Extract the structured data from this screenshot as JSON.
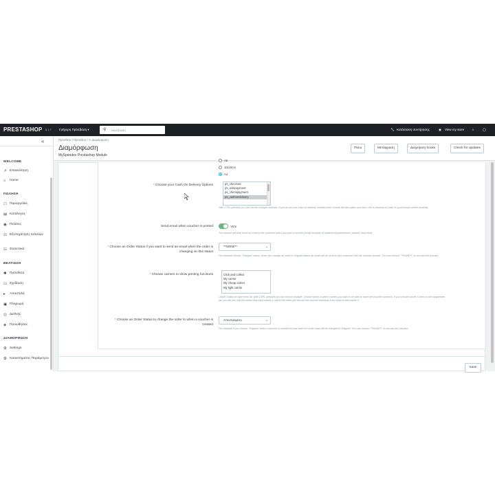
{
  "topbar": {
    "logo": "PRESTASHOP",
    "version": "8.1.7",
    "quick_access": "Γρήγορη Πρόσβαση ▾",
    "search_placeholder": "Αναζήτηση",
    "maintenance": "Κατάσταση συντήρησης",
    "view_store": "View my store"
  },
  "sidebar": {
    "sections": [
      {
        "title": "WELCOME",
        "items": [
          {
            "icon": "trend-icon",
            "label": "Επισκόπηση"
          },
          {
            "icon": "home-icon",
            "label": "Home"
          }
        ]
      },
      {
        "title": "ΠΩΛΗΣΗ",
        "items": [
          {
            "icon": "cart-icon",
            "label": "Παραγγελίες"
          },
          {
            "icon": "catalog-icon",
            "label": "Κατάλογος"
          },
          {
            "icon": "customer-icon",
            "label": "Πελάτες"
          },
          {
            "icon": "chat-icon",
            "label": "Εξυπηρέτηση πελατών"
          },
          {
            "icon": "stats-icon",
            "label": "Στατιστικά"
          }
        ]
      },
      {
        "title": "ΒΕΛΤΙΩΣΗ",
        "items": [
          {
            "icon": "puzzle-icon",
            "label": "Πρόσθετα"
          },
          {
            "icon": "monitor-icon",
            "label": "Σχεδίαση"
          },
          {
            "icon": "truck-icon",
            "label": "Αποστολή"
          },
          {
            "icon": "payment-icon",
            "label": "Πληρωμή"
          },
          {
            "icon": "globe-icon",
            "label": "Διεθνής"
          },
          {
            "icon": "promo-icon",
            "label": "Προωθήσεις"
          }
        ]
      },
      {
        "title": "ΔΙΑΜΟΡΦΩΣΗ",
        "items": [
          {
            "icon": "settings-icon",
            "label": "Settings"
          },
          {
            "icon": "params-icon",
            "label": "Καταστήματος Παράμετροι"
          }
        ]
      }
    ]
  },
  "header": {
    "breadcrumb": "Πρόσθετα  /  Πρόσθετα  /  ✎ Διαμόρφωση",
    "title": "Διαμόρφωση",
    "subtitle": "MySpeedex Prestashop Module",
    "buttons": [
      "Πίσω",
      "Μετάφραση",
      "Διαχείριση hooks",
      "Check for updates"
    ]
  },
  "form": {
    "radios": [
      {
        "label": "A6",
        "checked": false
      },
      {
        "label": "10x15cm",
        "checked": false
      },
      {
        "label": "A4",
        "checked": true
      }
    ],
    "cod_label": "Choose your Cash On Delivery Options",
    "cod_options": [
      "ps_checkout",
      "ps_wirepayment",
      "ps_checkpayment",
      "ps_cashondelivery"
    ],
    "cod_help": "With CTRL pressed you can choose multiple modules. If you do not use Cash on delivery modules then choose the last option and here, this is resolved in order to synchronize orders correctly",
    "email_label": "Send email when voucher is printed",
    "email_value": "YES",
    "email_help": "The module will auto send an email to the customer when you print a voucher (email template of mails/en/myspeedex/en_tracked_emp.html)",
    "status_email_label": "Choose an Order Status if you want to send an email when the order is changing on this status",
    "status_email_value": "**NONE**",
    "status_email_help": "For example choose \"Shipped\" status, when you change an order to Shipped status an email will be send to your customer with the voucher number. You can choose \"**NONE**\" to not use this function.",
    "carriers_label": "Choose carriers to show printing functions",
    "carriers": [
      "Click and collect",
      "My carrier",
      "My cheap carrier",
      "My light carrier"
    ],
    "carriers_help": "Leave it blank to have them all. With CTRL pressed you can choose multiple. Choose which in which carriers you want to be able to have the voucher functions. If you choose carrier X then on the myspeedex tab you will see only the orders that have carrier X and in the order you will see the voucher functions if the order is with carrier X",
    "status_change_label": "Choose an Order Status to change the order to when a voucher is created",
    "status_change_value": "Απεσταλμένο",
    "status_change_help": "For example if you choose \"Shipped\" when a voucher is created for that order the order state will be changed to Shipped. You can choose \"**NONE**\" to not use this function",
    "save": "Save"
  }
}
